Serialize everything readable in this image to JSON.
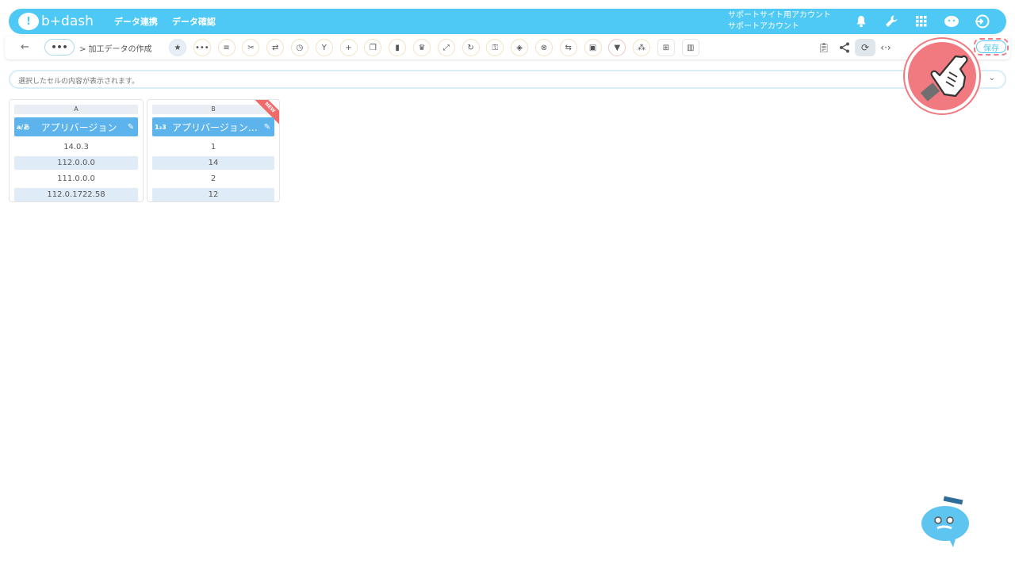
{
  "header": {
    "logo_text": "b+dash",
    "nav": [
      "データ連携",
      "データ確認"
    ],
    "account_line1": "サポートサイト用アカウント",
    "account_line2": "サポートアカウント",
    "icons": [
      "bell-icon",
      "wrench-icon",
      "grid-icon",
      "assistant-icon",
      "logout-icon"
    ]
  },
  "toolbar": {
    "back_label": "←",
    "more_label": "•••",
    "breadcrumb": "> 加工データの作成",
    "save_label": "保存",
    "tools": [
      "star-icon",
      "more-icon",
      "list-icon",
      "scissors-icon",
      "merge-icon",
      "timer-icon",
      "split-icon",
      "add-icon",
      "copy-icon",
      "trash-icon",
      "crown-icon",
      "expand-icon",
      "repeat-icon",
      "lock-icon",
      "cube-icon",
      "close-circle-icon",
      "replace-icon",
      "box-icon",
      "filter-icon",
      "format-icon",
      "table-icon",
      "columns-icon"
    ],
    "right_tools": [
      "clipboard-icon",
      "share-icon",
      "refresh-icon",
      "code-icon"
    ]
  },
  "cellbar": {
    "placeholder": "選択したセルの内容が表示されます。"
  },
  "columns": [
    {
      "letter": "A",
      "type": "a/あ",
      "title": "アプリバージョン",
      "cells": [
        "14.0.3",
        "112.0.0.0",
        "111.0.0.0",
        "112.0.1722.58"
      ]
    },
    {
      "letter": "B",
      "type": "1₂3",
      "title": "アプリバージョン(…",
      "badge": "NEW",
      "cells": [
        "1",
        "14",
        "2",
        "12"
      ]
    }
  ],
  "colors": {
    "brand": "#4ec9f5",
    "header_col": "#5db4ed",
    "highlight": "#f07a80"
  }
}
